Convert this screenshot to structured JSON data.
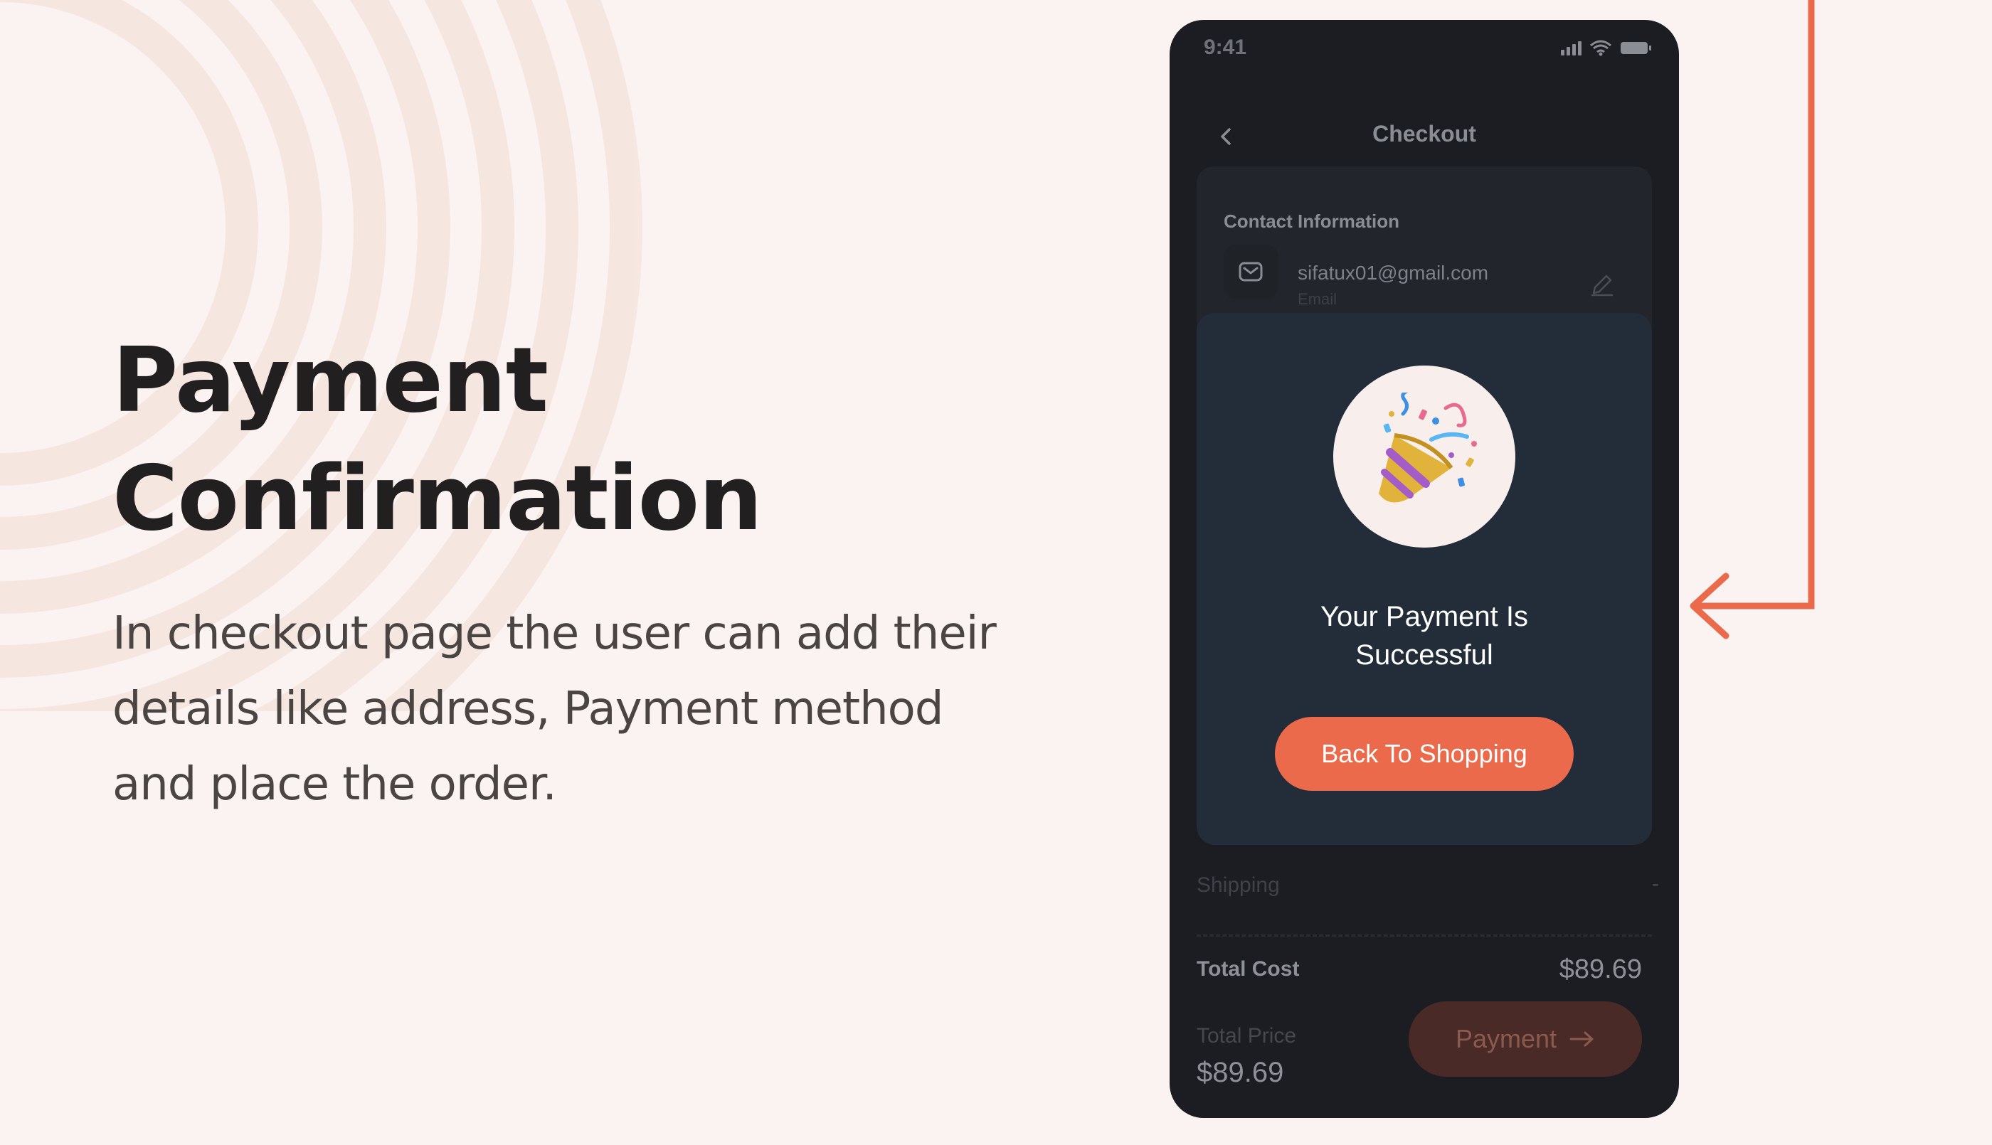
{
  "intro": {
    "title_line1": "Payment",
    "title_line2": "Confirmation",
    "description": "In checkout page the user can add their details like address, Payment method and place the order."
  },
  "phone": {
    "status_time": "9:41",
    "nav_title": "Checkout",
    "contact": {
      "section_title": "Contact Information",
      "email": "sifatux01@gmail.com",
      "email_label": "Email"
    },
    "summary": {
      "shipping_label": "Shipping",
      "shipping_value": "-",
      "total_cost_label": "Total Cost",
      "total_cost_value": "$89.69",
      "total_price_label": "Total Price",
      "total_price_value": "$89.69",
      "payment_button": "Payment"
    },
    "modal": {
      "message_line1": "Your Payment Is",
      "message_line2": "Successful",
      "button_label": "Back To Shopping"
    }
  },
  "icons": {
    "back": "chevron-left-icon",
    "mail": "mail-icon",
    "edit": "pencil-icon",
    "arrow": "arrow-right-icon",
    "celebration": "party-popper-icon"
  },
  "colors": {
    "accent": "#ec6a4c",
    "page_background": "#fbf3f1",
    "phone_background": "#1b1d22",
    "modal_background": "#232d39",
    "headline": "#211f1f"
  }
}
